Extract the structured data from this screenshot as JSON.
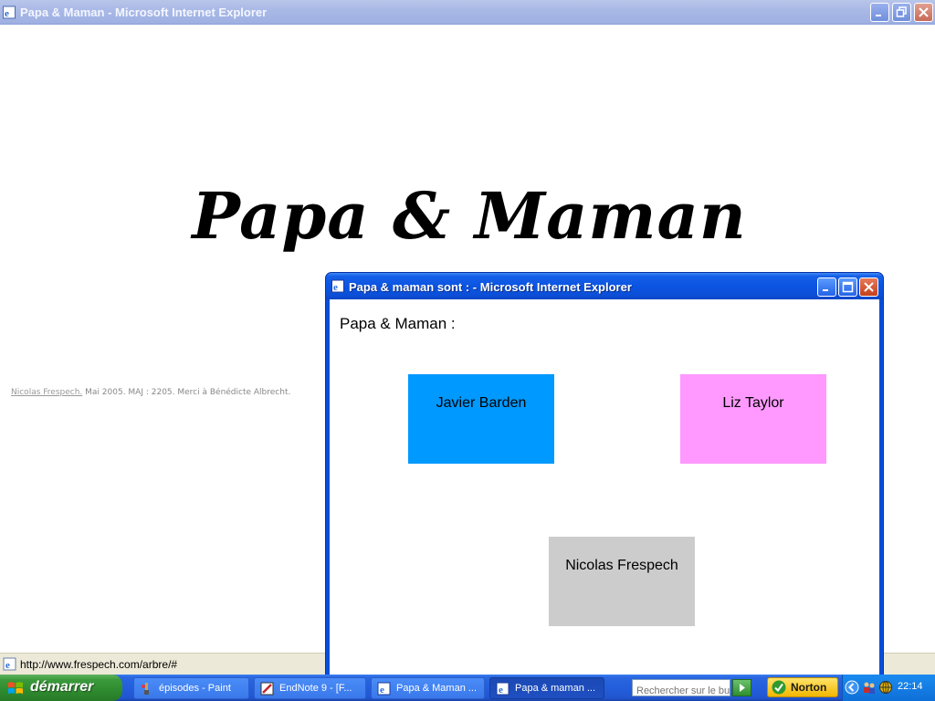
{
  "main_window": {
    "title": "Papa & Maman - Microsoft Internet Explorer",
    "page_heading": "Papa & Maman",
    "credit": {
      "author": "Nicolas Frespech.",
      "text": " Mai 2005. MAJ : 2205. Merci à Bénédicte Albrecht."
    },
    "status_url": "http://www.frespech.com/arbre/#"
  },
  "popup": {
    "title": "Papa & maman sont : - Microsoft Internet Explorer",
    "heading": "Papa & Maman :",
    "people": [
      {
        "name": "Javier Barden",
        "color": "#0099ff"
      },
      {
        "name": "Liz Taylor",
        "color": "#ff99ff"
      },
      {
        "name": "Nicolas Frespech",
        "color": "#cccccc"
      }
    ]
  },
  "taskbar": {
    "start_label": "démarrer",
    "tasks": [
      {
        "label": "épisodes - Paint",
        "icon": "paint-icon"
      },
      {
        "label": "EndNote 9 - [F...",
        "icon": "endnote-icon"
      },
      {
        "label": "Papa & Maman ...",
        "icon": "ie-icon"
      },
      {
        "label": "Papa & maman ...",
        "icon": "ie-icon"
      }
    ],
    "search_placeholder": "Rechercher sur le bur",
    "norton_label": "Norton",
    "clock": "22:14"
  }
}
